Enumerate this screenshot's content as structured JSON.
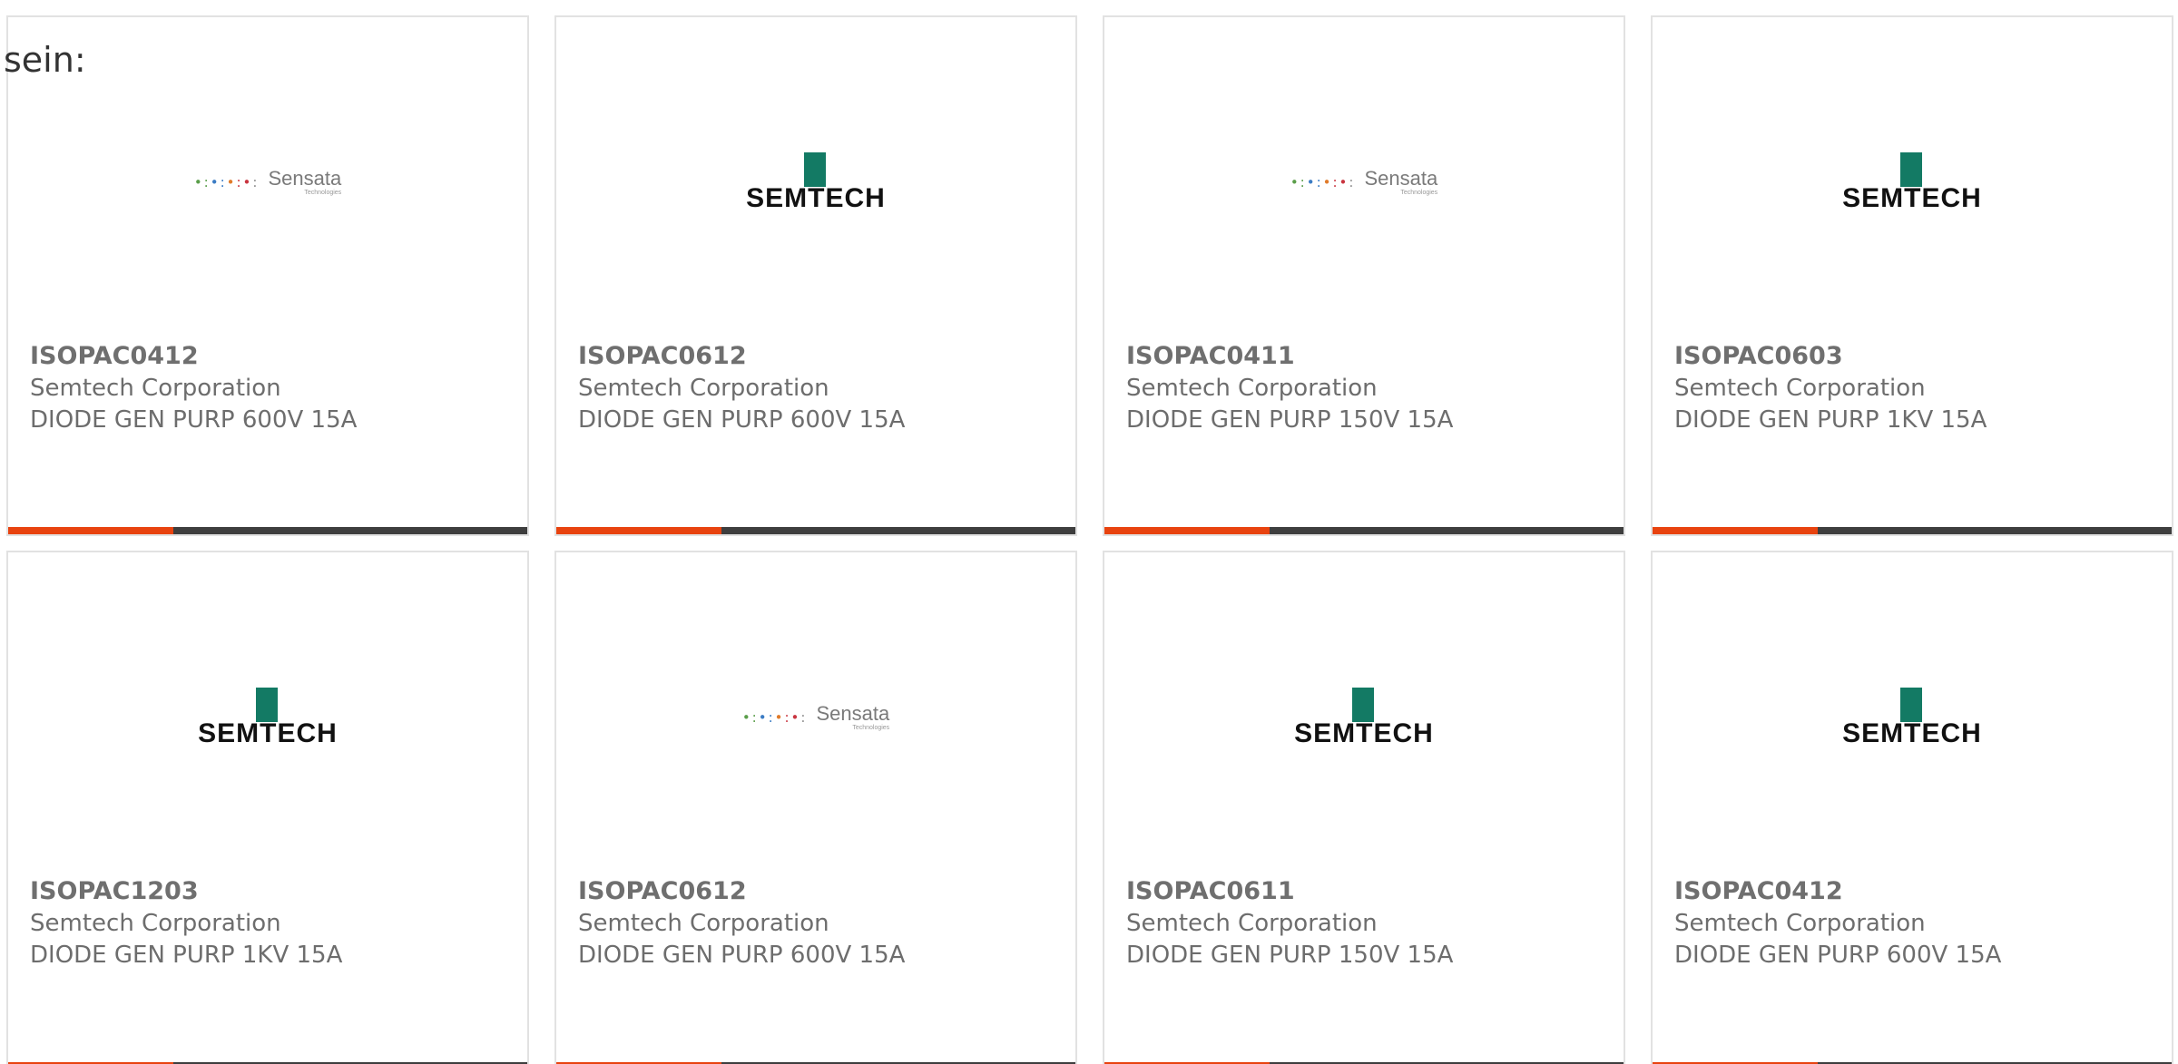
{
  "intro_text": "sein:",
  "colors": {
    "accent_bar": "#e8430f",
    "dark_bar": "#3e3e3e",
    "semtech_green": "#137a64"
  },
  "cards": [
    {
      "part": "ISOPAC0412",
      "maker": "Semtech Corporation",
      "desc": "DIODE GEN PURP 600V 15A",
      "logo": "sensata",
      "logo_text": "Sensata",
      "logo_sub": "Technologies"
    },
    {
      "part": "ISOPAC0612",
      "maker": "Semtech Corporation",
      "desc": "DIODE GEN PURP 600V 15A",
      "logo": "semtech",
      "logo_text": "SEMTECH"
    },
    {
      "part": "ISOPAC0411",
      "maker": "Semtech Corporation",
      "desc": "DIODE GEN PURP 150V 15A",
      "logo": "sensata",
      "logo_text": "Sensata",
      "logo_sub": "Technologies"
    },
    {
      "part": "ISOPAC0603",
      "maker": "Semtech Corporation",
      "desc": "DIODE GEN PURP 1KV 15A",
      "logo": "semtech",
      "logo_text": "SEMTECH"
    },
    {
      "part": "ISOPAC1203",
      "maker": "Semtech Corporation",
      "desc": "DIODE GEN PURP 1KV 15A",
      "logo": "semtech",
      "logo_text": "SEMTECH"
    },
    {
      "part": "ISOPAC0612",
      "maker": "Semtech Corporation",
      "desc": "DIODE GEN PURP 600V 15A",
      "logo": "sensata",
      "logo_text": "Sensata",
      "logo_sub": "Technologies"
    },
    {
      "part": "ISOPAC0611",
      "maker": "Semtech Corporation",
      "desc": "DIODE GEN PURP 150V 15A",
      "logo": "semtech",
      "logo_text": "SEMTECH"
    },
    {
      "part": "ISOPAC0412",
      "maker": "Semtech Corporation",
      "desc": "DIODE GEN PURP 600V 15A",
      "logo": "semtech",
      "logo_text": "SEMTECH"
    }
  ]
}
